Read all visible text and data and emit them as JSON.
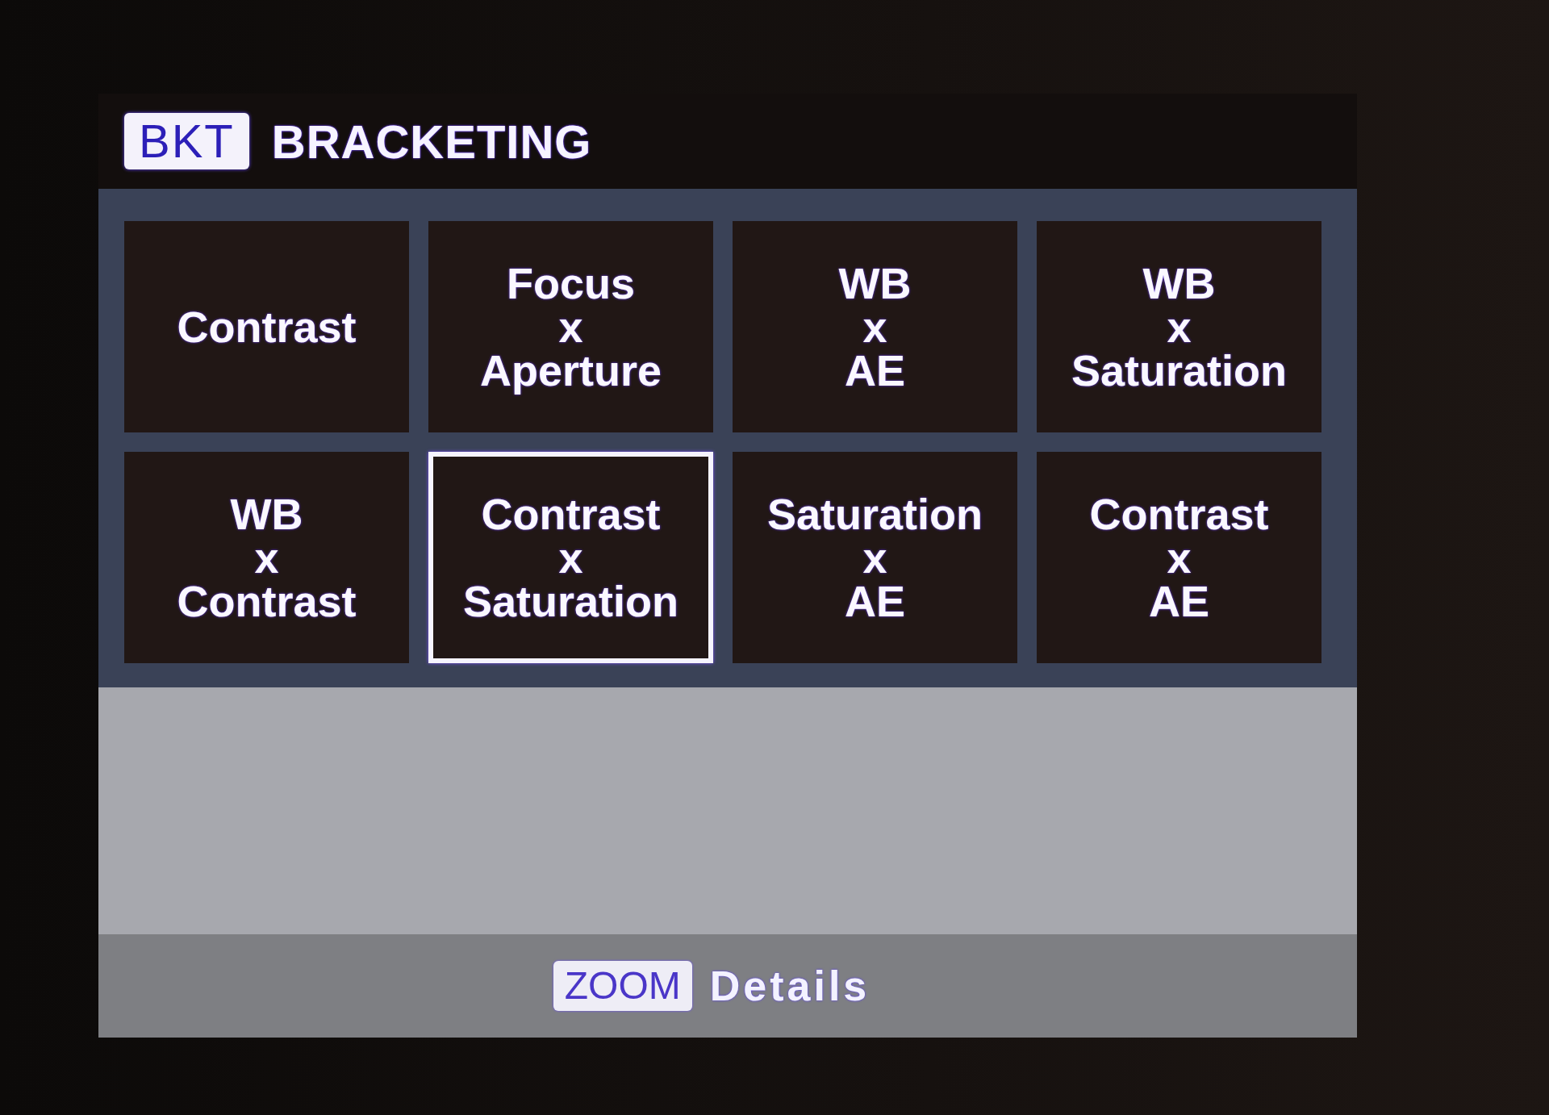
{
  "header": {
    "badge": "BKT",
    "title": "BRACKETING"
  },
  "options": [
    {
      "lines": [
        "Contrast"
      ],
      "selected": false
    },
    {
      "lines": [
        "Focus",
        "x",
        "Aperture"
      ],
      "selected": false
    },
    {
      "lines": [
        "WB",
        "x",
        "AE"
      ],
      "selected": false
    },
    {
      "lines": [
        "WB",
        "x",
        "Saturation"
      ],
      "selected": false
    },
    {
      "lines": [
        "WB",
        "x",
        "Contrast"
      ],
      "selected": false
    },
    {
      "lines": [
        "Contrast",
        "x",
        "Saturation"
      ],
      "selected": true
    },
    {
      "lines": [
        "Saturation",
        "x",
        "AE"
      ],
      "selected": false
    },
    {
      "lines": [
        "Contrast",
        "x",
        "AE"
      ],
      "selected": false
    }
  ],
  "footer": {
    "key": "ZOOM",
    "label": "Details"
  }
}
